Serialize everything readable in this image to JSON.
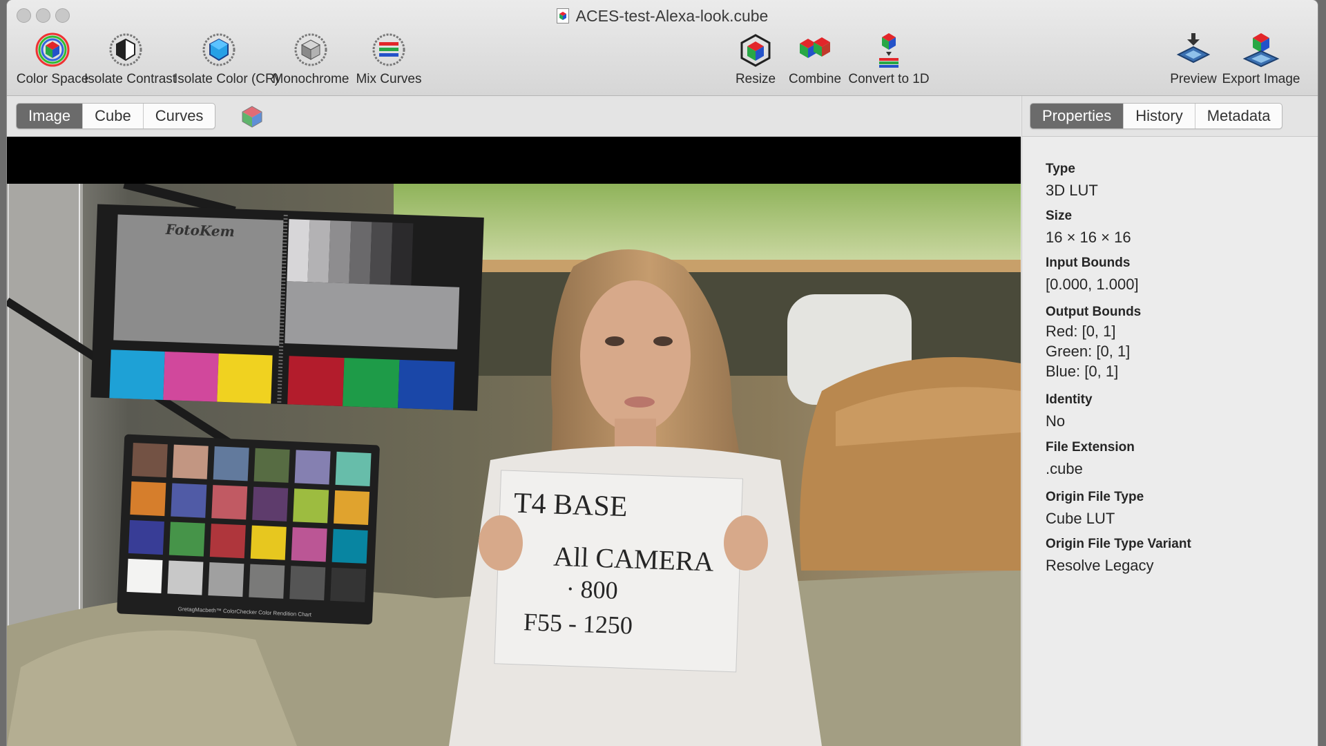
{
  "window": {
    "title": "ACES-test-Alexa-look.cube"
  },
  "toolbar": {
    "left_tools": [
      {
        "label": "Color Space",
        "icon": "color-space-icon"
      },
      {
        "label": "Isolate Contrast",
        "icon": "isolate-contrast-icon"
      },
      {
        "label": "Isolate Color (CR)",
        "icon": "isolate-color-icon"
      },
      {
        "label": "Monochrome",
        "icon": "monochrome-icon"
      },
      {
        "label": "Mix Curves",
        "icon": "mix-curves-icon"
      }
    ],
    "center_tools": [
      {
        "label": "Resize",
        "icon": "resize-icon"
      },
      {
        "label": "Combine",
        "icon": "combine-icon"
      },
      {
        "label": "Convert to 1D",
        "icon": "convert-to-1d-icon"
      }
    ],
    "right_tools": [
      {
        "label": "Preview",
        "icon": "preview-icon"
      },
      {
        "label": "Export Image",
        "icon": "export-image-icon"
      }
    ]
  },
  "view_tabs": {
    "items": [
      "Image",
      "Cube",
      "Curves"
    ],
    "active": "Image"
  },
  "inspector_tabs": {
    "items": [
      "Properties",
      "History",
      "Metadata"
    ],
    "active": "Properties"
  },
  "properties": [
    {
      "label": "Type",
      "value": "3D LUT"
    },
    {
      "label": "Size",
      "value": "16 × 16 × 16"
    },
    {
      "label": "Input Bounds",
      "value": "[0.000, 1.000]"
    },
    {
      "label": "Output Bounds",
      "lines": [
        "Red: [0, 1]",
        "Green: [0, 1]",
        "Blue: [0, 1]"
      ]
    },
    {
      "label": "Identity",
      "value": "No"
    },
    {
      "label": "File Extension",
      "value": ".cube"
    },
    {
      "label": "Origin File Type",
      "value": "Cube LUT"
    },
    {
      "label": "Origin File Type Variant",
      "value": "Resolve Legacy"
    }
  ],
  "photo": {
    "gray_card_brand": "FotoKem",
    "chart_caption": "GretagMacbeth™ ColorChecker Color Rendition Chart",
    "slate_lines": [
      "T4   BASE",
      "All CAMERA",
      "· 800",
      "F55 - 1250"
    ],
    "checker_colors": [
      "#735244",
      "#c29682",
      "#627a9d",
      "#576c43",
      "#8580b1",
      "#67bdaa",
      "#d67e2c",
      "#505ba6",
      "#c15a63",
      "#5e3c6c",
      "#9dbc40",
      "#e0a32e",
      "#383d96",
      "#469449",
      "#af363c",
      "#e7c71f",
      "#bb5695",
      "#0885a1",
      "#f3f3f2",
      "#c8c8c8",
      "#a0a0a0",
      "#7a7a79",
      "#555555",
      "#343434"
    ]
  }
}
